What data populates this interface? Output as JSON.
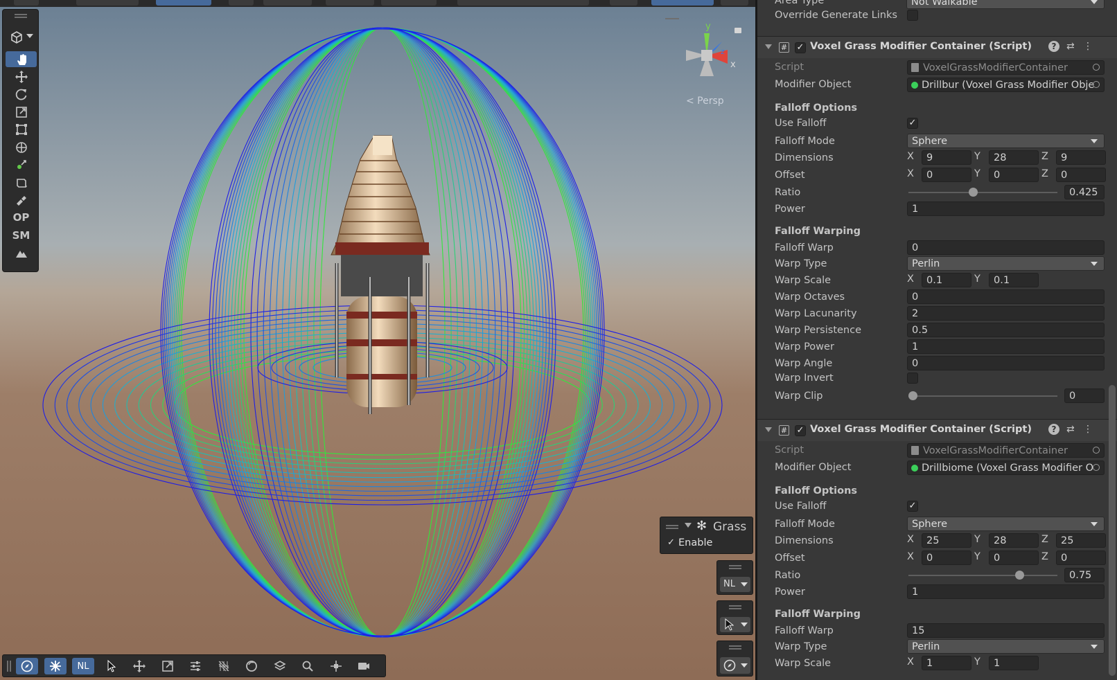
{
  "scene": {
    "persp_label": "< Persp",
    "gizmo_axes": {
      "x": "x",
      "y": "y",
      "z": "z"
    },
    "tools": [
      {
        "name": "hand-tool",
        "label": "",
        "icon": "hand-icon",
        "active": true
      },
      {
        "name": "move-tool",
        "label": "",
        "icon": "move-icon"
      },
      {
        "name": "rotate-tool",
        "label": "",
        "icon": "rotate-icon"
      },
      {
        "name": "scale-tool",
        "label": "",
        "icon": "scale-icon"
      },
      {
        "name": "rect-tool",
        "label": "",
        "icon": "rect-icon"
      },
      {
        "name": "transform-tool",
        "label": "",
        "icon": "transform-icon"
      },
      {
        "name": "custom-tool",
        "label": "",
        "icon": "pivot-icon"
      },
      {
        "name": "probuilder-tool",
        "label": "",
        "icon": "cube-icon"
      },
      {
        "name": "edit-tool",
        "label": "",
        "icon": "paint-icon"
      },
      {
        "name": "op-tool",
        "label": "OP",
        "icon": ""
      },
      {
        "name": "sm-tool",
        "label": "SM",
        "icon": ""
      },
      {
        "name": "terrain-tool",
        "label": "",
        "icon": "terrain-icon"
      }
    ],
    "grass_overlay": {
      "title": "Grass",
      "enable_label": "Enable",
      "enabled": true
    },
    "nl_dropdown": "NL",
    "bottom_bar": [
      {
        "name": "compass-button",
        "label": "",
        "icon": "compass-icon",
        "active": true
      },
      {
        "name": "grass-button",
        "label": "",
        "icon": "grass-icon",
        "active": true
      },
      {
        "name": "nl-button",
        "label": "NL",
        "icon": "",
        "active": true
      },
      {
        "name": "select-button",
        "label": "",
        "icon": "cursor-icon"
      },
      {
        "name": "move-button",
        "label": "",
        "icon": "move-icon"
      },
      {
        "name": "scale-button",
        "label": "",
        "icon": "scale-icon"
      },
      {
        "name": "settings-button",
        "label": "",
        "icon": "sliders-icon"
      },
      {
        "name": "grid-button",
        "label": "",
        "icon": "grid-icon"
      },
      {
        "name": "sphere-button",
        "label": "",
        "icon": "sphere-icon"
      },
      {
        "name": "layers-button",
        "label": "",
        "icon": "layers-icon"
      },
      {
        "name": "search-button",
        "label": "",
        "icon": "search-icon"
      },
      {
        "name": "snap-button",
        "label": "",
        "icon": "snap-icon"
      },
      {
        "name": "camera-button",
        "label": "",
        "icon": "camera-icon"
      }
    ]
  },
  "inspector": {
    "area_type_label": "Area Type",
    "area_type_value": "Not Walkable",
    "override_links_label": "Override Generate Links",
    "components": [
      {
        "title": "Voxel Grass Modifier Container (Script)",
        "script_label": "Script",
        "script_value": "VoxelGrassModifierContainer",
        "modifier_label": "Modifier Object",
        "modifier_value": "Drillbur (Voxel Grass Modifier Obje",
        "falloff_options": "Falloff Options",
        "use_falloff_label": "Use Falloff",
        "use_falloff": true,
        "falloff_mode_label": "Falloff Mode",
        "falloff_mode": "Sphere",
        "dimensions_label": "Dimensions",
        "dimensions": {
          "x": "9",
          "y": "28",
          "z": "9"
        },
        "offset_label": "Offset",
        "offset": {
          "x": "0",
          "y": "0",
          "z": "0"
        },
        "ratio_label": "Ratio",
        "ratio": "0.425",
        "ratio_fraction": 0.425,
        "power_label": "Power",
        "power": "1",
        "falloff_warping": "Falloff Warping",
        "falloff_warp_label": "Falloff Warp",
        "falloff_warp": "0",
        "warp_type_label": "Warp Type",
        "warp_type": "Perlin",
        "warp_scale_label": "Warp Scale",
        "warp_scale": {
          "x": "0.1",
          "y": "0.1"
        },
        "warp_octaves_label": "Warp Octaves",
        "warp_octaves": "0",
        "warp_lacunarity_label": "Warp Lacunarity",
        "warp_lacunarity": "2",
        "warp_persistence_label": "Warp Persistence",
        "warp_persistence": "0.5",
        "warp_power_label": "Warp Power",
        "warp_power": "1",
        "warp_angle_label": "Warp Angle",
        "warp_angle": "0",
        "warp_invert_label": "Warp Invert",
        "warp_invert": false,
        "warp_clip_label": "Warp Clip",
        "warp_clip": "0",
        "warp_clip_fraction": 0
      },
      {
        "title": "Voxel Grass Modifier Container (Script)",
        "script_label": "Script",
        "script_value": "VoxelGrassModifierContainer",
        "modifier_label": "Modifier Object",
        "modifier_value": "Drillbiome (Voxel Grass Modifier O",
        "falloff_options": "Falloff Options",
        "use_falloff_label": "Use Falloff",
        "use_falloff": true,
        "falloff_mode_label": "Falloff Mode",
        "falloff_mode": "Sphere",
        "dimensions_label": "Dimensions",
        "dimensions": {
          "x": "25",
          "y": "28",
          "z": "25"
        },
        "offset_label": "Offset",
        "offset": {
          "x": "0",
          "y": "0",
          "z": "0"
        },
        "ratio_label": "Ratio",
        "ratio": "0.75",
        "ratio_fraction": 0.75,
        "power_label": "Power",
        "power": "1",
        "falloff_warping": "Falloff Warping",
        "falloff_warp_label": "Falloff Warp",
        "falloff_warp": "15",
        "warp_type_label": "Warp Type",
        "warp_type": "Perlin",
        "warp_scale_label": "Warp Scale",
        "warp_scale": {
          "x": "1",
          "y": "1"
        }
      }
    ]
  },
  "colors": {
    "accent": "#466a9b",
    "panel": "#383838",
    "field": "#2a2a2a"
  }
}
